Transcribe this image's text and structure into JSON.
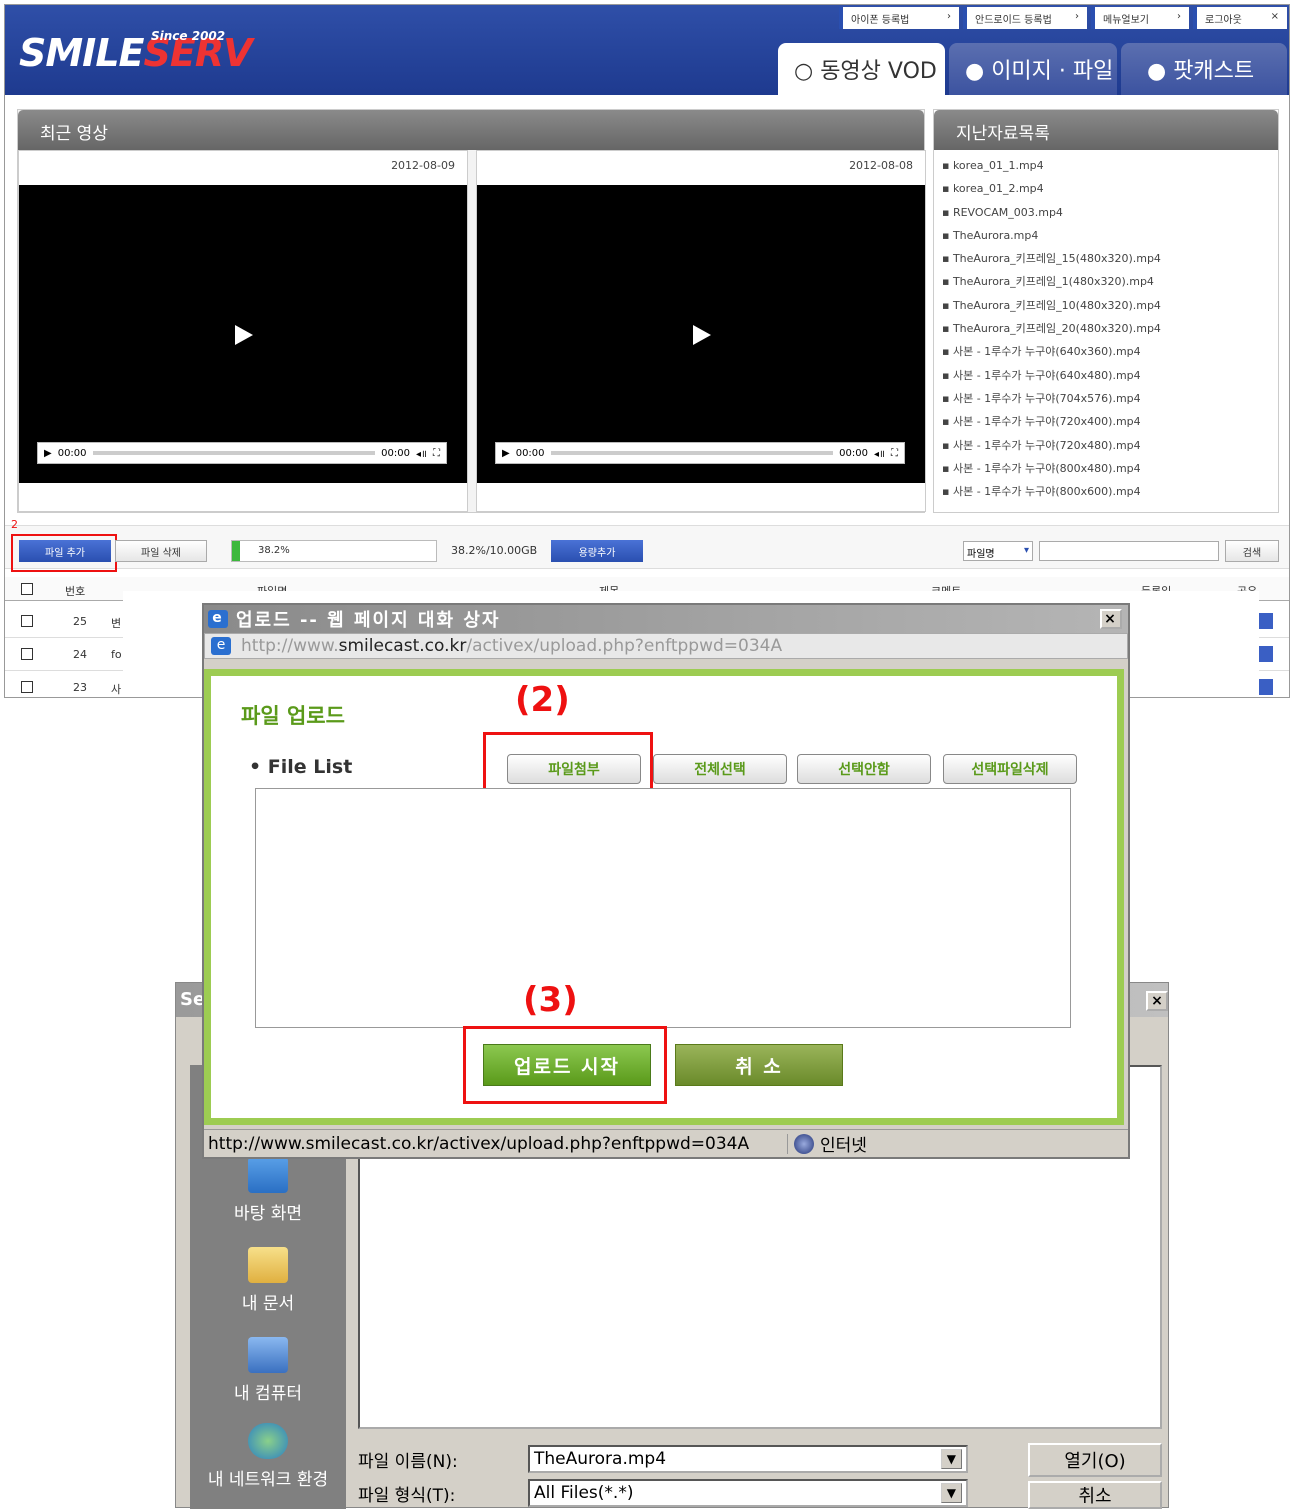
{
  "site": {
    "logo_text_white": "SMILE",
    "logo_text_red": "SERV",
    "since": "Since 2002",
    "top_links": [
      {
        "label": "아이폰 등록법",
        "arrow": "›"
      },
      {
        "label": "안드로이드 등록법",
        "arrow": "›"
      },
      {
        "label": "메뉴얼보기",
        "arrow": "›"
      },
      {
        "label": "로그아웃",
        "arrow": "×"
      }
    ],
    "tabs": [
      {
        "label": "○ 동영상 VOD",
        "active": true
      },
      {
        "label": "● 이미지 · 파일",
        "active": false
      },
      {
        "label": "● 팟캐스트",
        "active": false
      }
    ]
  },
  "recent": {
    "title": "최근 영상",
    "videos": [
      {
        "date": "2012-08-09",
        "time_start": "00:00",
        "time_end": "00:00"
      },
      {
        "date": "2012-08-08",
        "time_start": "00:00",
        "time_end": "00:00"
      }
    ]
  },
  "archive": {
    "title": "지난자료목록",
    "items": [
      "korea_01_1.mp4",
      "korea_01_2.mp4",
      "REVOCAM_003.mp4",
      "TheAurora.mp4",
      "TheAurora_키프레임_15(480x320).mp4",
      "TheAurora_키프레임_1(480x320).mp4",
      "TheAurora_키프레임_10(480x320).mp4",
      "TheAurora_키프레임_20(480x320).mp4",
      "사본 - 1루수가 누구야(640x360).mp4",
      "사본 - 1루수가 누구야(640x480).mp4",
      "사본 - 1루수가 누구야(704x576).mp4",
      "사본 - 1루수가 누구야(720x400).mp4",
      "사본 - 1루수가 누구야(720x480).mp4",
      "사본 - 1루수가 누구야(800x480).mp4",
      "사본 - 1루수가 누구야(800x600).mp4"
    ]
  },
  "toolbar": {
    "marker": "2",
    "add_file": "파일 추가",
    "delete_file": "파일 삭제",
    "usage_percent_label": "38.2%",
    "usage_fraction": 0.382,
    "usage_text": "38.2%/10.00GB",
    "add_capacity": "용량추가",
    "search_field_select": "파일명",
    "search_button": "검색"
  },
  "table": {
    "headers": [
      "번호",
      "파일명",
      "제목",
      "코멘트",
      "등록일",
      "공유"
    ],
    "rows": [
      {
        "num": "25",
        "name": "변"
      },
      {
        "num": "24",
        "name": "fo"
      },
      {
        "num": "23",
        "name": "사"
      }
    ]
  },
  "upload_dialog": {
    "title": "업로드 -- 웹 페이지 대화 상자",
    "close": "×",
    "url_gray": "http://www.",
    "url_dark": "smilecast.co.kr",
    "url_rest": "/activex/upload.php?enftppwd=034A",
    "heading": "파일 업로드",
    "file_list_label": "• File List",
    "annotation_2": "(2)",
    "annotation_3": "(3)",
    "buttons": [
      "파일첨부",
      "전체선택",
      "선택안함",
      "선택파일삭제"
    ],
    "start_upload": "업로드 시작",
    "cancel": "취 소",
    "status_url": "http://www.smilecast.co.kr/activex/upload.php?enftppwd=034A",
    "status_zone": "인터넷"
  },
  "file_dialog": {
    "title_partial": "Se",
    "close": "×",
    "places": [
      "바탕 화면",
      "내 문서",
      "내 컴퓨터",
      "내 네트워크 환경"
    ],
    "filename_label": "파일 이름(N):",
    "filename_value": "TheAurora.mp4",
    "filetype_label": "파일 형식(T):",
    "filetype_value": "All Files(*.*)",
    "open_button": "열기(O)",
    "cancel_button": "취소"
  },
  "colors": {
    "header_blue": "#2a4fb0",
    "accent_red": "#e11",
    "green_frame": "#9dcc52",
    "green_button": "#6aab2c",
    "olive_button": "#7d9a3c"
  }
}
